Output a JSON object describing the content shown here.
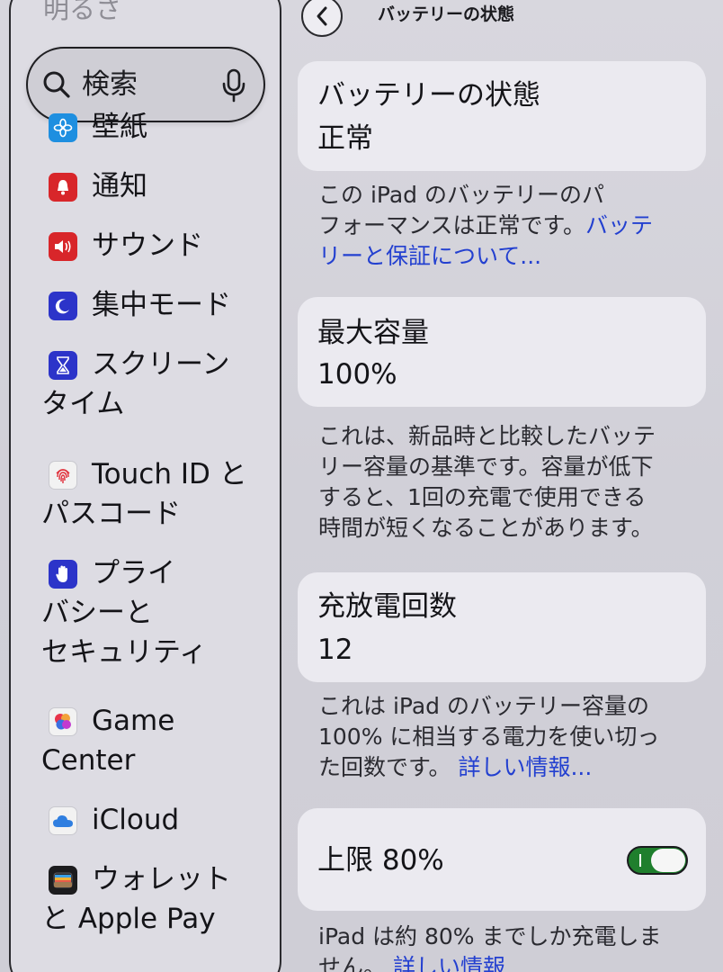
{
  "sidebar": {
    "title_partial": "明るさ",
    "search": {
      "label": "検索"
    },
    "items": [
      {
        "label": "壁紙",
        "icon": "wallpaper-icon",
        "color": "#1e8fe0"
      },
      {
        "label": "通知",
        "icon": "bell-icon",
        "color": "#d8262a"
      },
      {
        "label": "サウンド",
        "icon": "speaker-icon",
        "color": "#d8262a"
      },
      {
        "label": "集中モード",
        "icon": "moon-icon",
        "color": "#2c34c9"
      },
      {
        "label": "スクリーン",
        "label2": "タイム",
        "icon": "hourglass-icon",
        "color": "#2c34c9"
      },
      {
        "label": "Touch ID と",
        "label2": "パスコード",
        "icon": "fingerprint-icon",
        "color": "#f2f2f2"
      },
      {
        "label": "プライ",
        "label2": "バシーと",
        "label3": "セキュリティ",
        "icon": "hand-icon",
        "color": "#2c34c9"
      },
      {
        "label": "Game",
        "label2": "Center",
        "icon": "game-center-icon",
        "color": "#f2f2f2"
      },
      {
        "label": "iCloud",
        "icon": "cloud-icon",
        "color": "#f2f2f2"
      },
      {
        "label": "ウォレット",
        "label2": "と Apple Pay",
        "icon": "wallet-icon",
        "color": "#1c1c1e"
      }
    ]
  },
  "nav": {
    "title": "バッテリーの状態"
  },
  "cards": {
    "health": {
      "title": "バッテリーの状態",
      "value": "正常"
    },
    "capacity": {
      "title": "最大容量",
      "value": "100%"
    },
    "cycles": {
      "title": "充放電回数",
      "value": "12"
    },
    "limit": {
      "title": "上限 80%",
      "toggle_on": true,
      "toggle_color": "#1f7f2d"
    }
  },
  "descriptions": {
    "health": {
      "line1": "この iPad のバッテリーのパ",
      "line2_text": "フォーマンスは正常です。",
      "line2_link": "バッテ",
      "line3_link": "リーと保証について..."
    },
    "capacity": {
      "line1": "これは、新品時と比較したバッテ",
      "line2": "リー容量の基準です。容量が低下",
      "line3": "すると、1回の充電で使用できる",
      "line4": "時間が短くなることがあります。"
    },
    "cycles": {
      "line1": "これは iPad のバッテリー容量の",
      "line2": "100% に相当する電力を使い切っ",
      "line3_text": "た回数です。",
      "line3_link": "詳しい情報..."
    },
    "limit": {
      "line1": "iPad は約 80% までしか充電しま",
      "line2_text": "せん。",
      "line2_link": "詳しい情報"
    }
  },
  "colors": {
    "link": "#2340d0",
    "card_bg": "#ebeaf0"
  }
}
